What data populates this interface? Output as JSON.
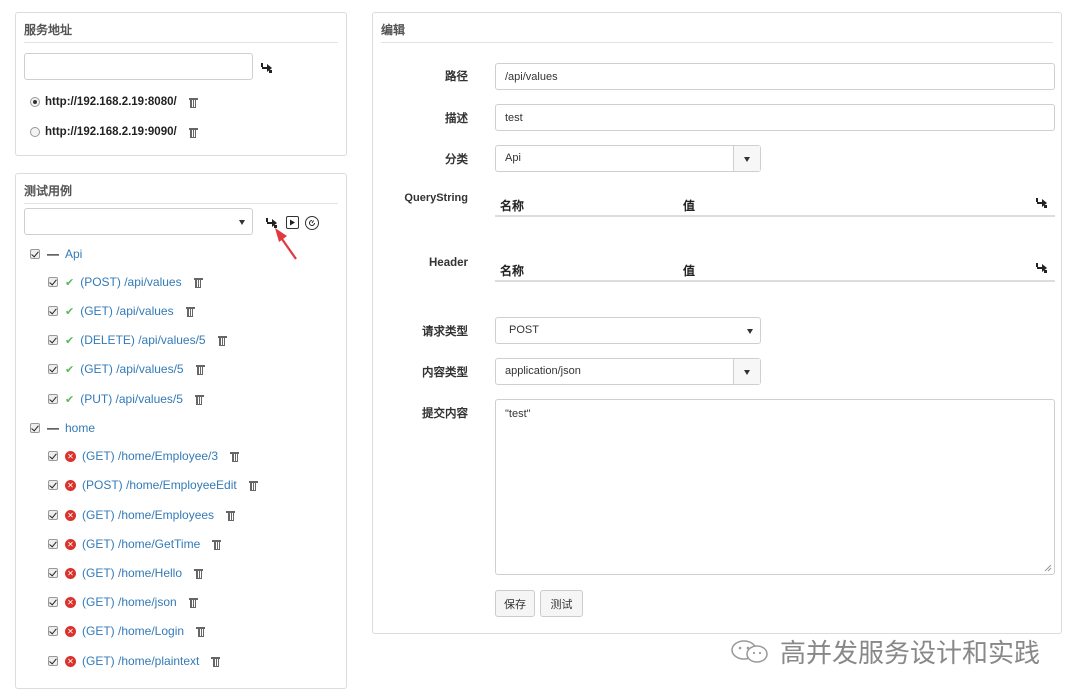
{
  "server_panel": {
    "title": "服务地址",
    "input_value": "",
    "icon": "add-icon",
    "servers": [
      {
        "url": "http://192.168.2.19:8080/",
        "selected": true
      },
      {
        "url": "http://192.168.2.19:9090/",
        "selected": false
      }
    ]
  },
  "tests_panel": {
    "title": "测试用例",
    "select_value": "",
    "icons": [
      "add-icon",
      "play-icon",
      "timer-icon"
    ],
    "groups": [
      {
        "label": "Api",
        "items": [
          {
            "label": "(POST) /api/values",
            "status": "ok"
          },
          {
            "label": "(GET) /api/values",
            "status": "ok"
          },
          {
            "label": "(DELETE) /api/values/5",
            "status": "ok"
          },
          {
            "label": "(GET) /api/values/5",
            "status": "ok"
          },
          {
            "label": "(PUT) /api/values/5",
            "status": "ok"
          }
        ]
      },
      {
        "label": "home",
        "items": [
          {
            "label": "(GET) /home/Employee/3",
            "status": "error"
          },
          {
            "label": "(POST) /home/EmployeeEdit",
            "status": "error"
          },
          {
            "label": "(GET) /home/Employees",
            "status": "error"
          },
          {
            "label": "(GET) /home/GetTime",
            "status": "error"
          },
          {
            "label": "(GET) /home/Hello",
            "status": "error"
          },
          {
            "label": "(GET) /home/json",
            "status": "error"
          },
          {
            "label": "(GET) /home/Login",
            "status": "error"
          },
          {
            "label": "(GET) /home/plaintext",
            "status": "error"
          }
        ]
      }
    ]
  },
  "edit_panel": {
    "title": "编辑",
    "path_label": "路径",
    "path_value": "/api/values",
    "desc_label": "描述",
    "desc_value": "test",
    "category_label": "分类",
    "category_value": "Api",
    "querystring_label": "QueryString",
    "header_label": "Header",
    "col_name": "名称",
    "col_value": "值",
    "method_label": "请求类型",
    "method_value": "POST",
    "content_type_label": "内容类型",
    "content_type_value": "application/json",
    "body_label": "提交内容",
    "body_value": "\"test\"",
    "save_label": "保存",
    "test_label": "测试"
  },
  "watermark": {
    "text": "高并发服务设计和实践"
  },
  "colors": {
    "link": "#337ab7",
    "ok": "#5cb85c",
    "error": "#d9332c",
    "arrow": "#e03a3e"
  }
}
